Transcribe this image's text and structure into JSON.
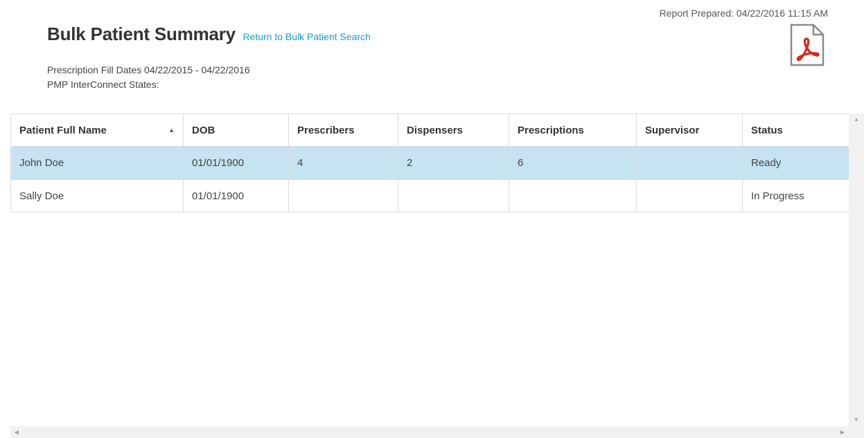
{
  "header": {
    "report_prepared": "Report Prepared: 04/22/2016 11:15 AM",
    "title": "Bulk Patient Summary",
    "return_link": "Return to Bulk Patient Search",
    "fill_dates": "Prescription Fill Dates 04/22/2015 - 04/22/2016",
    "interconnect_states": "PMP InterConnect States:",
    "pdf_icon": "pdf-icon"
  },
  "grid": {
    "columns": [
      "Patient Full Name",
      "DOB",
      "Prescribers",
      "Dispensers",
      "Prescriptions",
      "Supervisor",
      "Status"
    ],
    "sort_indicator": "▲",
    "rows": [
      {
        "name": "John Doe",
        "dob": "01/01/1900",
        "prescribers": "4",
        "dispensers": "2",
        "prescriptions": "6",
        "supervisor": "",
        "status": "Ready"
      },
      {
        "name": "Sally Doe",
        "dob": "01/01/1900",
        "prescribers": "",
        "dispensers": "",
        "prescriptions": "",
        "supervisor": "",
        "status": "In Progress"
      }
    ]
  },
  "colors": {
    "link": "#1a9bd7",
    "selected_row": "#c5e3f1",
    "status_ready": "#3e9a3e",
    "pdf_red": "#d9261c"
  }
}
